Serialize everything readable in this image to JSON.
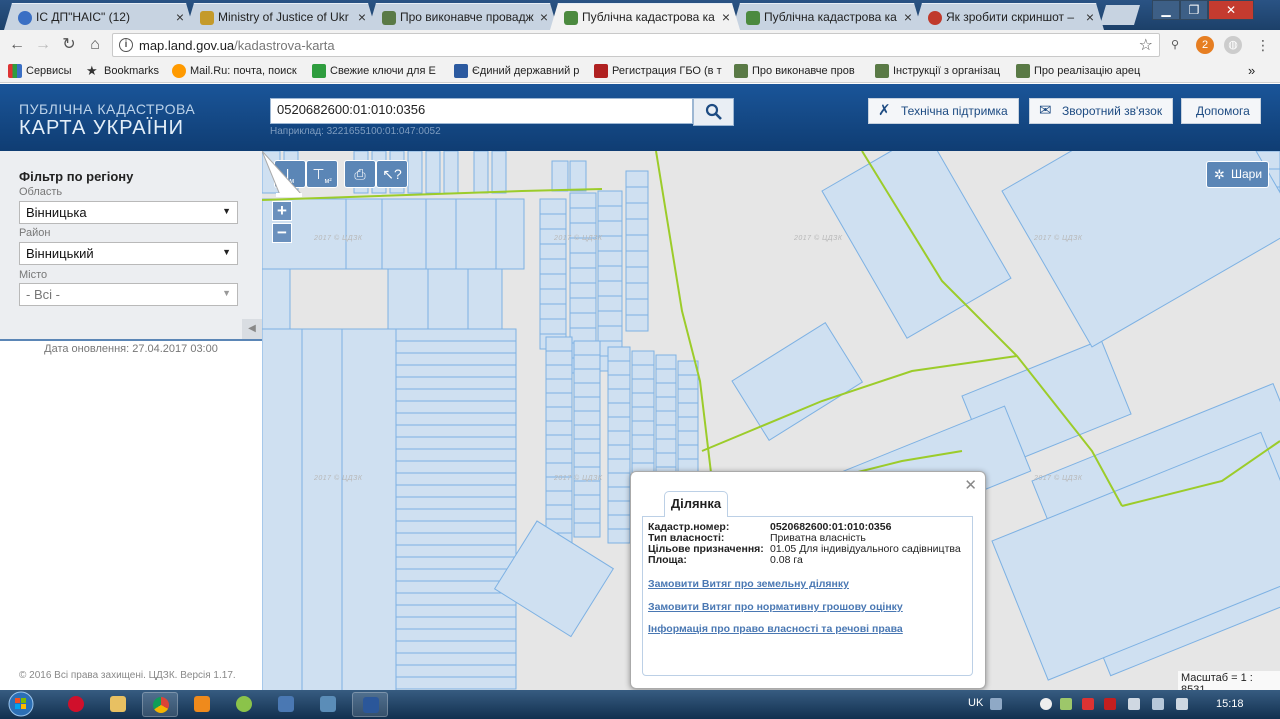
{
  "browser": {
    "tabs": [
      {
        "title": "ІС ДП\"НАІС\" (12)",
        "favicon_color": "#3a6fc4"
      },
      {
        "title": "Ministry of Justice of Ukr",
        "favicon_color": "#c49a2a"
      },
      {
        "title": "Про виконавче провадж",
        "favicon_color": "#5a7a46"
      },
      {
        "title": "Публічна кадастрова ка",
        "favicon_color": "#4c8a3f"
      },
      {
        "title": "Публічна кадастрова ка",
        "favicon_color": "#4c8a3f"
      },
      {
        "title": "Як зробити скриншот –",
        "favicon_color": "#c0392b"
      }
    ],
    "active_tab": 3,
    "url_host": "map.land.gov.ua",
    "url_path": "/kadastrova-karta",
    "bookmarks": [
      {
        "label": "Сервисы",
        "icon_color": "#d33"
      },
      {
        "label": "Bookmarks",
        "icon_color": "#333"
      },
      {
        "label": "Mail.Ru: почта, поиск",
        "icon_color": "#ff9a00"
      },
      {
        "label": "Свежие ключи для E",
        "icon_color": "#2e9d3e"
      },
      {
        "label": "Єдиний державний р",
        "icon_color": "#2c5aa0"
      },
      {
        "label": "Регистрация ГБО (в т",
        "icon_color": "#b02121"
      },
      {
        "label": "Про виконавче пров",
        "icon_color": "#5a7a46"
      },
      {
        "label": "Інструкції з організац",
        "icon_color": "#5a7a46"
      },
      {
        "label": "Про реалізацію арец",
        "icon_color": "#5a7a46"
      }
    ],
    "more_bookmarks": "»"
  },
  "site": {
    "logo_line1": "ПУБЛІЧНА КАДАСТРОВА",
    "logo_line2": "КАРТА УКРАЇНИ",
    "search_value": "0520682600:01:010:0356",
    "search_hint": "Наприклад: 3221655100:01:047:0052",
    "support_button": "Технічна підтримка",
    "feedback_button": "Зворотний зв'язок",
    "help_button": "Допомога"
  },
  "filter": {
    "title": "Фільтр по регіону",
    "oblast_label": "Область",
    "oblast_value": "Вінницька",
    "rayon_label": "Район",
    "rayon_value": "Вінницький",
    "city_label": "Місто",
    "city_value": "- Всі -",
    "updated": "Дата оновлення: 27.04.2017 03:00",
    "copyright": "© 2016 Всі права захищені. ЦДЗК. Версія 1.17."
  },
  "map": {
    "layers_button": "Шари",
    "zoom_in": "+",
    "zoom_out": "−",
    "watermark": "2017 © ЦДЗК",
    "scale_text": "Масштаб = 1 : 8531",
    "parcel_fill": "#cfe0f1",
    "parcel_stroke": "#7db1e3",
    "boundary_color": "#9ccc2a"
  },
  "popup": {
    "tab_label": "Ділянка",
    "rows": [
      {
        "key": "Кадастр.номер:",
        "value": "0520682600:01:010:0356"
      },
      {
        "key": "Тип власності:",
        "value": "Приватна власність"
      },
      {
        "key": "Цільове призначення:",
        "value": "01.05 Для індивідуального садівництва"
      },
      {
        "key": "Площа:",
        "value": "0.08 га"
      }
    ],
    "link_extract": "Замовити Витяг про земельну ділянку",
    "link_valuation": "Замовити Витяг про нормативну грошову оцінку",
    "link_rights": "Інформація про право власності та речові права"
  },
  "taskbar": {
    "lang": "UK",
    "time": "15:18"
  }
}
